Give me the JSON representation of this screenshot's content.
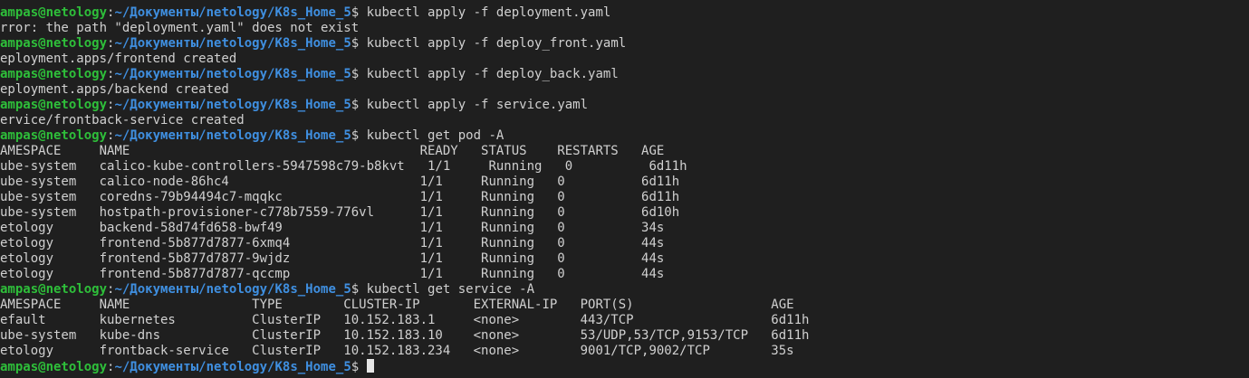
{
  "prompt": {
    "user_host": "ampas@netology",
    "separator": ":",
    "path": "~/Документы/netology/K8s_Home_5",
    "symbol": "$ "
  },
  "lines": [
    {
      "type": "prompt",
      "text": "kubectl apply -f deployment.yaml"
    },
    {
      "type": "output",
      "text": "rror: the path \"deployment.yaml\" does not exist"
    },
    {
      "type": "prompt",
      "text": "kubectl apply -f deploy_front.yaml"
    },
    {
      "type": "output",
      "text": "eployment.apps/frontend created"
    },
    {
      "type": "prompt",
      "text": "kubectl apply -f deploy_back.yaml"
    },
    {
      "type": "output",
      "text": "eployment.apps/backend created"
    },
    {
      "type": "prompt",
      "text": "kubectl apply -f service.yaml"
    },
    {
      "type": "output",
      "text": "ervice/frontback-service created"
    },
    {
      "type": "prompt",
      "text": "kubectl get pod -A"
    },
    {
      "type": "output",
      "text": "AMESPACE     NAME                                      READY   STATUS    RESTARTS   AGE"
    },
    {
      "type": "output",
      "text": "ube-system   calico-kube-controllers-5947598c79-b8kvt   1/1     Running   0          6d11h"
    },
    {
      "type": "output",
      "text": "ube-system   calico-node-86hc4                         1/1     Running   0          6d11h"
    },
    {
      "type": "output",
      "text": "ube-system   coredns-79b94494c7-mqqkc                  1/1     Running   0          6d11h"
    },
    {
      "type": "output",
      "text": "ube-system   hostpath-provisioner-c778b7559-776vl      1/1     Running   0          6d10h"
    },
    {
      "type": "output",
      "text": "etology      backend-58d74fd658-bwf49                  1/1     Running   0          34s"
    },
    {
      "type": "output",
      "text": "etology      frontend-5b877d7877-6xmq4                 1/1     Running   0          44s"
    },
    {
      "type": "output",
      "text": "etology      frontend-5b877d7877-9wjdz                 1/1     Running   0          44s"
    },
    {
      "type": "output",
      "text": "etology      frontend-5b877d7877-qccmp                 1/1     Running   0          44s"
    },
    {
      "type": "prompt",
      "text": "kubectl get service -A"
    },
    {
      "type": "output",
      "text": "AMESPACE     NAME                TYPE        CLUSTER-IP       EXTERNAL-IP   PORT(S)                  AGE"
    },
    {
      "type": "output",
      "text": "efault       kubernetes          ClusterIP   10.152.183.1     <none>        443/TCP                  6d11h"
    },
    {
      "type": "output",
      "text": "ube-system   kube-dns            ClusterIP   10.152.183.10    <none>        53/UDP,53/TCP,9153/TCP   6d11h"
    },
    {
      "type": "output",
      "text": "etology      frontback-service   ClusterIP   10.152.183.234   <none>        9001/TCP,9002/TCP        35s"
    },
    {
      "type": "prompt",
      "text": "",
      "cursor": true
    }
  ],
  "colors": {
    "background": "#1f1f1f",
    "text": "#d0d0d0",
    "user_host": "#2ebf3a",
    "path": "#3f8fe0"
  }
}
